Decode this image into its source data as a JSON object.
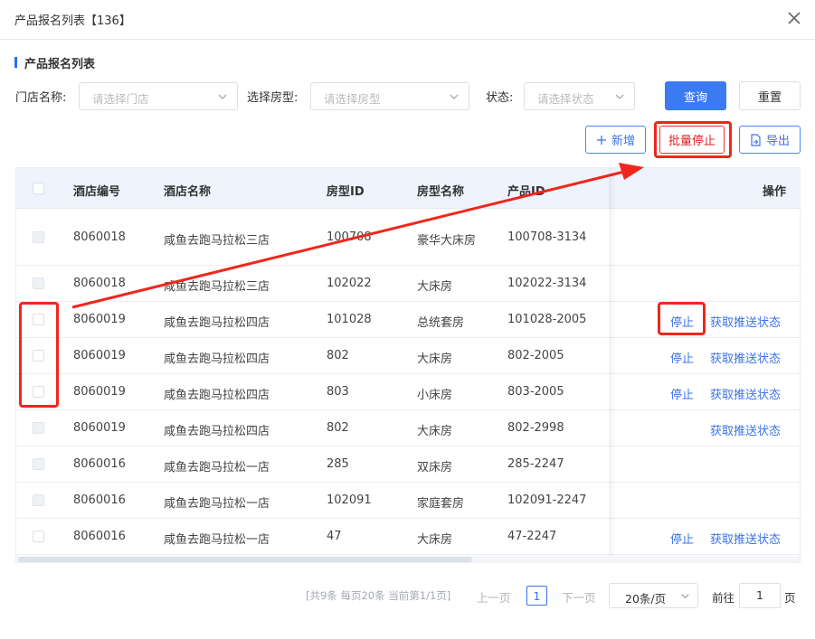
{
  "dialog": {
    "title": "产品报名列表【136】",
    "section_title": "产品报名列表"
  },
  "filters": {
    "store_label": "门店名称:",
    "store_placeholder": "请选择门店",
    "room_label": "选择房型:",
    "room_placeholder": "请选择房型",
    "status_label": "状态:",
    "status_placeholder": "请选择状态"
  },
  "buttons": {
    "query": "查询",
    "reset": "重置",
    "add": "新增",
    "batch_stop": "批量停止",
    "export": "导出"
  },
  "table": {
    "columns": [
      "酒店编号",
      "酒店名称",
      "房型ID",
      "房型名称",
      "产品ID",
      "操作"
    ],
    "rows": [
      {
        "hotel_no": "8060018",
        "hotel_name": "咸鱼去跑马拉松三店",
        "room_id": "100708",
        "room_name": "豪华大床房",
        "product_id": "100708-3134",
        "checkbox_enabled": false,
        "stop": "",
        "fetch": ""
      },
      {
        "hotel_no": "8060018",
        "hotel_name": "咸鱼去跑马拉松三店",
        "room_id": "102022",
        "room_name": "大床房",
        "product_id": "102022-3134",
        "checkbox_enabled": false,
        "stop": "",
        "fetch": ""
      },
      {
        "hotel_no": "8060019",
        "hotel_name": "咸鱼去跑马拉松四店",
        "room_id": "101028",
        "room_name": "总统套房",
        "product_id": "101028-2005",
        "checkbox_enabled": true,
        "stop": "停止",
        "fetch": "获取推送状态"
      },
      {
        "hotel_no": "8060019",
        "hotel_name": "咸鱼去跑马拉松四店",
        "room_id": "802",
        "room_name": "大床房",
        "product_id": "802-2005",
        "checkbox_enabled": true,
        "stop": "停止",
        "fetch": "获取推送状态"
      },
      {
        "hotel_no": "8060019",
        "hotel_name": "咸鱼去跑马拉松四店",
        "room_id": "803",
        "room_name": "小床房",
        "product_id": "803-2005",
        "checkbox_enabled": true,
        "stop": "停止",
        "fetch": "获取推送状态"
      },
      {
        "hotel_no": "8060019",
        "hotel_name": "咸鱼去跑马拉松四店",
        "room_id": "802",
        "room_name": "大床房",
        "product_id": "802-2998",
        "checkbox_enabled": false,
        "stop": "",
        "fetch": "获取推送状态"
      },
      {
        "hotel_no": "8060016",
        "hotel_name": "咸鱼去跑马拉松一店",
        "room_id": "285",
        "room_name": "双床房",
        "product_id": "285-2247",
        "checkbox_enabled": false,
        "stop": "",
        "fetch": ""
      },
      {
        "hotel_no": "8060016",
        "hotel_name": "咸鱼去跑马拉松一店",
        "room_id": "102091",
        "room_name": "家庭套房",
        "product_id": "102091-2247",
        "checkbox_enabled": false,
        "stop": "",
        "fetch": ""
      },
      {
        "hotel_no": "8060016",
        "hotel_name": "咸鱼去跑马拉松一店",
        "room_id": "47",
        "room_name": "大床房",
        "product_id": "47-2247",
        "checkbox_enabled": true,
        "stop": "停止",
        "fetch": "获取推送状态"
      }
    ]
  },
  "pagination": {
    "summary": "[共9条 每页20条 当前第1/1页]",
    "prev": "上一页",
    "current": "1",
    "next": "下一页",
    "page_size": "20条/页",
    "goto_label": "前往",
    "goto_value": "1",
    "page_suffix": "页"
  },
  "colors": {
    "primary": "#3a7bf2",
    "annotation_red": "#f0261c",
    "header_bg": "#eef3fd"
  }
}
